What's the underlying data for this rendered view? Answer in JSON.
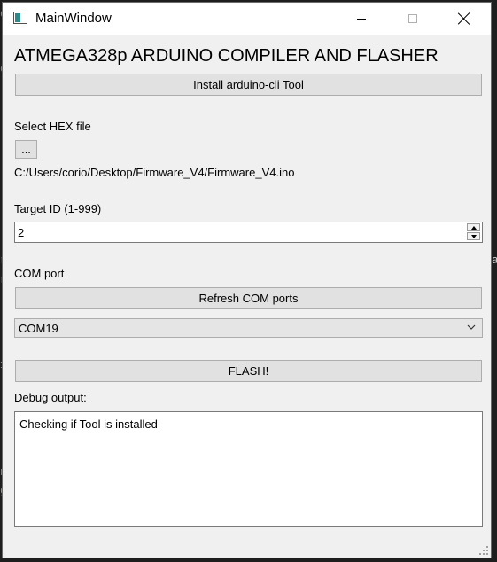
{
  "window": {
    "title": "MainWindow"
  },
  "main": {
    "heading": "ATMEGA328p ARDUINO COMPILER AND FLASHER",
    "install_button": "Install arduino-cli Tool",
    "hex_label": "Select HEX file",
    "browse_button": "...",
    "file_path": "C:/Users/corio/Desktop/Firmware_V4/Firmware_V4.ino",
    "target_label": "Target ID (1-999)",
    "target_value": "2",
    "com_label": "COM port",
    "refresh_button": "Refresh COM ports",
    "com_selected": "COM19",
    "flash_button": "FLASH!",
    "debug_label": "Debug output:",
    "debug_text": "Checking if Tool is installed"
  },
  "icons": {
    "app": "window-icon",
    "minimize": "minimize-icon",
    "maximize": "maximize-icon",
    "close": "close-icon",
    "combo": "chevron-down-icon",
    "spin_up": "spin-up-icon",
    "spin_down": "spin-down-icon",
    "grip": "resize-grip-icon"
  },
  "colors": {
    "window_bg": "#f0f0f0",
    "button_bg": "#e1e1e1",
    "button_border": "#adadad",
    "titlebar_bg": "#ffffff"
  }
}
